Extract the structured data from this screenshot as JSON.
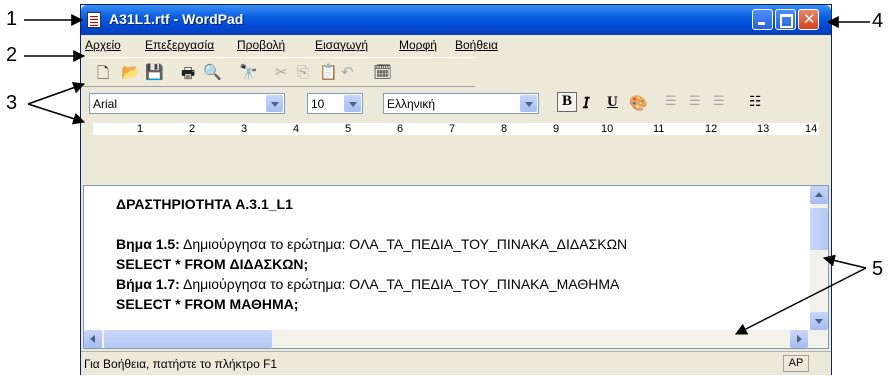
{
  "callouts": [
    "1",
    "2",
    "3",
    "4",
    "5"
  ],
  "window": {
    "title": "A31L1.rtf - WordPad",
    "controls": {
      "minimize": "",
      "maximize": "",
      "close": "✕"
    }
  },
  "menubar": [
    "Αρχείο",
    "Επεξεργασία",
    "Προβολή",
    "Εισαγωγή",
    "Μορφή",
    "Βοήθεια"
  ],
  "toolbar": {
    "icons": [
      "new-icon",
      "open-icon",
      "save-icon",
      "print-icon",
      "print-preview-icon",
      "find-icon",
      "cut-icon",
      "copy-icon",
      "paste-icon",
      "undo-icon",
      "date-time-icon"
    ]
  },
  "format_bar": {
    "font": "Arial",
    "size": "10",
    "script": "Ελληνική",
    "bold": "B",
    "italic": "𝘐",
    "underline": "U",
    "icons": [
      "color-icon",
      "align-left-icon",
      "align-center-icon",
      "align-right-icon",
      "bullets-icon"
    ]
  },
  "ruler": [
    "1",
    "2",
    "3",
    "4",
    "5",
    "6",
    "7",
    "8",
    "9",
    "10",
    "11",
    "12",
    "13",
    "14"
  ],
  "document": {
    "heading": "ΔΡΑΣΤΗΡΙΟΤΗΤΑ Α.3.1_L1",
    "lines": [
      {
        "label": "Βημα 1.5:",
        "text": " Δημιούργησα το ερώτημα: ΟΛΑ_ΤΑ_ΠΕΔΙΑ_ΤΟΥ_ΠΙΝΑΚΑ_ΔΙΔΑΣΚΩΝ"
      },
      {
        "label": "SELECT * FROM ΔΙΔΑΣΚΩΝ;",
        "text": ""
      },
      {
        "label": "Βήμα 1.7:",
        "text": " Δημιούργησα το ερώτημα: ΟΛΑ_ΤΑ_ΠΕΔΙΑ_ΤΟΥ_ΠΙΝΑΚΑ_ΜΑΘΗΜΑ"
      },
      {
        "label": "SELECT * FROM ΜΑΘΗΜΑ;",
        "text": ""
      }
    ]
  },
  "statusbar": {
    "message": "Για Βοήθεια, πατήστε το πλήκτρο F1",
    "caps": "AP"
  }
}
